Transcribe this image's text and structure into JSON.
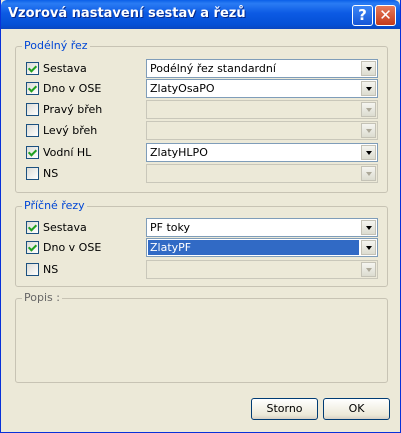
{
  "window": {
    "title": "Vzorová nastavení sestav a řezů",
    "help_label": "?",
    "close_label": "✕"
  },
  "podelny": {
    "label": "Podélný řez",
    "rows": [
      {
        "label": "Sestava",
        "checked": true,
        "value": "Podélný řez standardní",
        "enabled": true
      },
      {
        "label": "Dno v OSE",
        "checked": true,
        "value": "ZlatyOsaPO",
        "enabled": true
      },
      {
        "label": "Pravý břeh",
        "checked": false,
        "value": "",
        "enabled": false
      },
      {
        "label": "Levý břeh",
        "checked": false,
        "value": "",
        "enabled": false
      },
      {
        "label": "Vodní HL",
        "checked": true,
        "value": "ZlatyHLPO",
        "enabled": true
      },
      {
        "label": "NS",
        "checked": false,
        "value": "",
        "enabled": false
      }
    ]
  },
  "pricne": {
    "label": "Příčné řezy",
    "rows": [
      {
        "label": "Sestava",
        "checked": true,
        "value": "PF toky",
        "enabled": true
      },
      {
        "label": "Dno v OSE",
        "checked": true,
        "value": "ZlatyPF",
        "enabled": true,
        "selected": true
      },
      {
        "label": "NS",
        "checked": false,
        "value": "",
        "enabled": false
      }
    ]
  },
  "popis": {
    "label": "Popis :"
  },
  "buttons": {
    "cancel": "Storno",
    "ok": "OK"
  }
}
